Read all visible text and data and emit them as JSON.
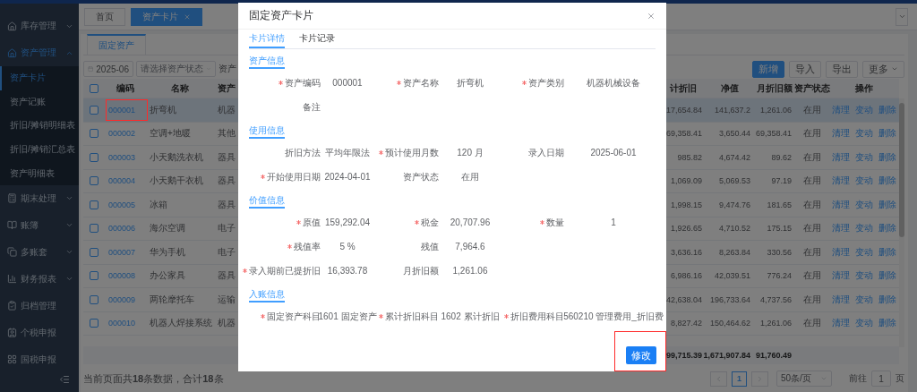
{
  "top_tabs": [
    {
      "label": "首页",
      "selected": false,
      "closable": false
    },
    {
      "label": "资产卡片",
      "selected": true,
      "closable": true
    }
  ],
  "sidebar": {
    "items": [
      {
        "label": "库存管理",
        "selected": false,
        "expanded": false
      },
      {
        "label": "资产管理",
        "selected": true,
        "expanded": true,
        "children": [
          {
            "label": "资产卡片",
            "selected": true
          },
          {
            "label": "资产记账",
            "selected": false
          },
          {
            "label": "折旧/摊销明细表",
            "selected": false
          },
          {
            "label": "折旧/摊销汇总表",
            "selected": false
          },
          {
            "label": "资产明细表",
            "selected": false
          }
        ]
      },
      {
        "label": "期末处理",
        "selected": false,
        "expanded": false
      },
      {
        "label": "账簿",
        "selected": false,
        "expanded": false
      },
      {
        "label": "多账套",
        "selected": false,
        "expanded": false
      },
      {
        "label": "财务报表",
        "selected": false,
        "expanded": false
      },
      {
        "label": "归档管理",
        "selected": false
      },
      {
        "label": "个税申报",
        "selected": false
      },
      {
        "label": "国税申报",
        "selected": false
      }
    ]
  },
  "sub_tabs": [
    {
      "label": "固定资产",
      "selected": true
    }
  ],
  "filters": {
    "period": "2025-06",
    "status": {
      "placeholder": "请选择资产状态"
    },
    "category_label": "资产"
  },
  "actions": [
    {
      "label": "新增",
      "primary": true,
      "dropdown": false
    },
    {
      "label": "导入",
      "primary": false,
      "dropdown": false
    },
    {
      "label": "导出",
      "primary": false,
      "dropdown": false
    },
    {
      "label": "更多",
      "primary": false,
      "dropdown": true
    }
  ],
  "table": {
    "all_checked": false,
    "columns": [
      "编码",
      "名称",
      "资产",
      "计折旧",
      "净值",
      "月折旧额",
      "资产状态",
      "操作"
    ],
    "rows": [
      {
        "selected": true,
        "checked": false,
        "annotated": true,
        "code": "000001",
        "name": "折弯机",
        "category": "机器",
        "accumulated": "17,654.84",
        "net": "141,637.2",
        "monthly": "1,261.06",
        "status": "在用",
        "actions": [
          "清理",
          "变动",
          "删除"
        ]
      },
      {
        "selected": false,
        "checked": false,
        "annotated": false,
        "code": "000002",
        "name": "空调+地暖",
        "category": "其他",
        "accumulated": "69,358.41",
        "net": "3,650.44",
        "monthly": "69,358.41",
        "status": "在用",
        "actions": [
          "清理",
          "变动",
          "删除"
        ]
      },
      {
        "selected": false,
        "checked": false,
        "annotated": false,
        "code": "000003",
        "name": "小天鹅洗衣机",
        "category": "器具",
        "accumulated": "985.82",
        "net": "4,674.42",
        "monthly": "89.62",
        "status": "在用",
        "actions": [
          "清理",
          "变动",
          "删除"
        ]
      },
      {
        "selected": false,
        "checked": false,
        "annotated": false,
        "code": "000004",
        "name": "小天鹅干衣机",
        "category": "器具",
        "accumulated": "1,069.09",
        "net": "5,069.53",
        "monthly": "97.19",
        "status": "在用",
        "actions": [
          "清理",
          "变动",
          "删除"
        ]
      },
      {
        "selected": false,
        "checked": false,
        "annotated": false,
        "code": "000005",
        "name": "冰箱",
        "category": "器具",
        "accumulated": "1,998.15",
        "net": "9,474.76",
        "monthly": "181.65",
        "status": "在用",
        "actions": [
          "清理",
          "变动",
          "删除"
        ]
      },
      {
        "selected": false,
        "checked": false,
        "annotated": false,
        "code": "000006",
        "name": "海尔空调",
        "category": "电子",
        "accumulated": "1,926.65",
        "net": "4,710.52",
        "monthly": "175.15",
        "status": "在用",
        "actions": [
          "清理",
          "变动",
          "删除"
        ]
      },
      {
        "selected": false,
        "checked": false,
        "annotated": false,
        "code": "000007",
        "name": "华为手机",
        "category": "电子",
        "accumulated": "3,636.16",
        "net": "8,263.84",
        "monthly": "330.56",
        "status": "在用",
        "actions": [
          "清理",
          "变动",
          "删除"
        ]
      },
      {
        "selected": false,
        "checked": false,
        "annotated": false,
        "code": "000008",
        "name": "办公家具",
        "category": "器具",
        "accumulated": "6,986.16",
        "net": "42,039.51",
        "monthly": "776.24",
        "status": "在用",
        "actions": [
          "清理",
          "变动",
          "删除"
        ]
      },
      {
        "selected": false,
        "checked": false,
        "annotated": false,
        "code": "000009",
        "name": "两轮摩托车",
        "category": "运输",
        "accumulated": "42,638.04",
        "net": "196,733.64",
        "monthly": "4,737.56",
        "status": "在用",
        "actions": [
          "清理",
          "变动",
          "删除"
        ]
      },
      {
        "selected": false,
        "checked": false,
        "annotated": false,
        "code": "000010",
        "name": "机器人焊接系统",
        "category": "机器",
        "accumulated": "8,827.42",
        "net": "150,464.62",
        "monthly": "1,261.06",
        "status": "在用",
        "actions": [
          "清理",
          "变动",
          "删除"
        ]
      }
    ],
    "totals": {
      "accumulated": "99,715.39",
      "net": "1,671,907.84",
      "monthly": "91,760.49"
    }
  },
  "footer": {
    "summary": "当前页面共**18**条数据，合计**18**条"
  },
  "pagination": {
    "pages": [
      {
        "label": "1",
        "selected": true
      }
    ],
    "page_size": "50条/页",
    "goto_label": "前往",
    "goto_value": "1",
    "page_unit": "页"
  },
  "modal": {
    "title": "固定资产卡片",
    "tabs": [
      {
        "label": "卡片详情",
        "selected": true
      },
      {
        "label": "卡片记录",
        "selected": false
      }
    ],
    "sections": [
      {
        "title": "资产信息",
        "rows": [
          [
            {
              "label": "资产编码",
              "value": "000001",
              "required": true
            },
            {
              "label": "资产名称",
              "value": "折弯机",
              "required": true
            },
            {
              "label": "资产类别",
              "value": "机器机械设备",
              "required": true
            }
          ],
          [
            {
              "label": "备注",
              "required": false
            }
          ]
        ]
      },
      {
        "title": "使用信息",
        "rows": [
          [
            {
              "label": "折旧方法",
              "value": "平均年限法",
              "required": false
            },
            {
              "label": "预计使用月数",
              "value": "120 月",
              "required": true
            },
            {
              "label": "录入日期",
              "value": "2025-06-01",
              "required": false
            }
          ],
          [
            {
              "label": "开始使用日期",
              "value": "2024-04-01",
              "required": true
            },
            {
              "label": "资产状态",
              "value": "在用",
              "required": false
            }
          ]
        ]
      },
      {
        "title": "价值信息",
        "rows": [
          [
            {
              "label": "原值",
              "value": "159,292.04",
              "required": true
            },
            {
              "label": "税金",
              "value": "20,707.96",
              "required": true
            },
            {
              "label": "数量",
              "value": "1",
              "required": true
            }
          ],
          [
            {
              "label": "残值率",
              "value": "5 %",
              "required": true
            },
            {
              "label": "残值",
              "value": "7,964.6",
              "required": false
            }
          ],
          [
            {
              "label": "录入期前已提折旧",
              "value": "16,393.78",
              "required": true
            },
            {
              "label": "月折旧额",
              "value": "1,261.06",
              "required": false
            }
          ]
        ]
      },
      {
        "title": "入账信息",
        "rows": [
          [
            {
              "label": "固定资产科目",
              "value": "1601 固定资产",
              "required": true
            },
            {
              "label": "累计折旧科目",
              "value": "1602 累计折旧",
              "required": true
            },
            {
              "label": "折旧费用科目",
              "value": "560210 管理费用_折旧费",
              "required": true
            }
          ]
        ]
      }
    ],
    "button": {
      "label": "修改",
      "annotated": true
    }
  }
}
